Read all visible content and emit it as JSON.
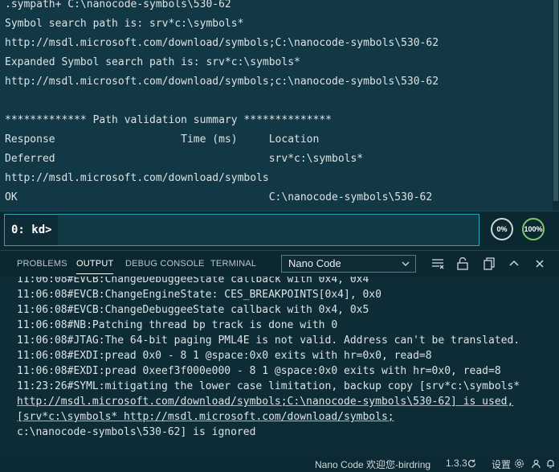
{
  "kd_output": {
    "lines": [
      ".sympath+ C:\\nanocode-symbols\\530-62",
      "Symbol search path is: srv*c:\\symbols*",
      "http://msdl.microsoft.com/download/symbols;C:\\nanocode-symbols\\530-62",
      "Expanded Symbol search path is: srv*c:\\symbols*",
      "http://msdl.microsoft.com/download/symbols;c:\\nanocode-symbols\\530-62",
      "",
      "************* Path validation summary **************",
      "Response                    Time (ms)     Location",
      "Deferred                                  srv*c:\\symbols*",
      "http://msdl.microsoft.com/download/symbols",
      "OK                                        C:\\nanocode-symbols\\530-62"
    ]
  },
  "command": {
    "prompt": "0: kd>",
    "value": "",
    "progress_left": "0%",
    "progress_right": "100%"
  },
  "panel": {
    "tabs": [
      {
        "label": "PROBLEMS",
        "active": false
      },
      {
        "label": "OUTPUT",
        "active": true
      },
      {
        "label": "DEBUG CONSOLE",
        "active": false
      },
      {
        "label": "TERMINAL",
        "active": false
      }
    ],
    "channel": "Nano Code",
    "icons": [
      "list-filter-icon",
      "lock-icon",
      "copy-icon",
      "chevron-up-icon",
      "close-icon"
    ]
  },
  "output": {
    "lines": [
      "11:06:08#EVCB:ChangeDebuggeeState callback with 0x4, 0x4",
      "11:06:08#EVCB:ChangeEngineState: CES_BREAKPOINTS[0x4], 0x0",
      "11:06:08#EVCB:ChangeDebuggeeState callback with 0x4, 0x5",
      "11:06:08#NB:Patching thread bp track is done with 0",
      "11:06:08#JTAG:The 64-bit paging PML4E is not valid. Address can't be translated.",
      "11:06:08#EXDI:pread 0x0 - 8 1 @space:0x0 exits with hr=0x0, read=8",
      "11:06:08#EXDI:pread 0xeef3f000e000 - 8 1 @space:0x0 exits with hr=0x0, read=8",
      "11:23:26#SYML:mitigating the lower case limitation, backup copy [srv*c:\\symbols*",
      "http://msdl.microsoft.com/download/symbols;C:\\nanocode-symbols\\530-62] is used,",
      "[srv*c:\\symbols* http://msdl.microsoft.com/download/symbols;",
      "c:\\nanocode-symbols\\530-62] is ignored"
    ]
  },
  "status": {
    "left": "Nano Code 欢迎您-birdring",
    "version": "1.3.3",
    "settings": "设置"
  }
}
